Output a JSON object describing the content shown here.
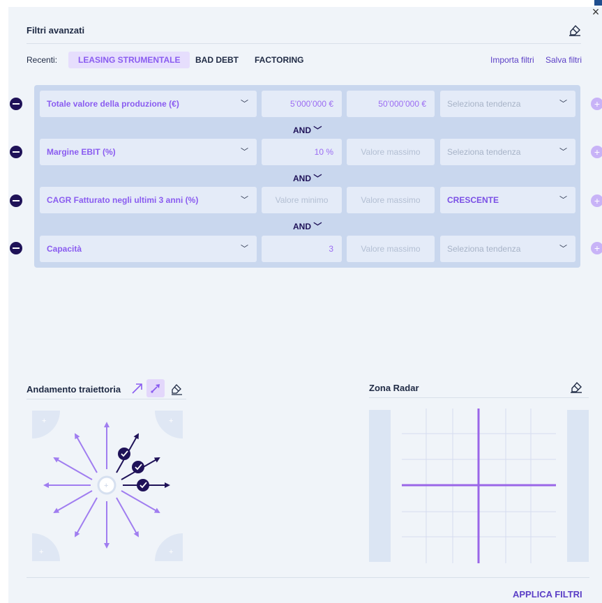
{
  "window": {
    "close_label": "×"
  },
  "header": {
    "title": "Filtri avanzati"
  },
  "recent": {
    "label": "Recenti:",
    "chips": [
      "LEASING STRUMENTALE",
      "BAD DEBT",
      "FACTORING"
    ],
    "import_label": "Importa filtri",
    "save_label": "Salva filtri"
  },
  "filters": [
    {
      "field": "Totale valore della produzione (€)",
      "min": "5’000’000  €",
      "max": "50’000’000  €",
      "trend": "Seleziona tendenza"
    },
    {
      "field": "Margine EBIT (%)",
      "min": "10  %",
      "max": "Valore massimo",
      "trend": "Seleziona tendenza"
    },
    {
      "field": "CAGR Fatturato negli ultimi 3 anni (%)",
      "min": "Valore minimo",
      "max": "Valore massimo",
      "trend": "CRESCENTE"
    },
    {
      "field": "Capacità",
      "min": "3",
      "max": "Valore massimo",
      "trend": "Seleziona tendenza"
    }
  ],
  "connectors": [
    "AND",
    "AND",
    "AND"
  ],
  "trajectory": {
    "title": "Andamento traiettoria"
  },
  "radar": {
    "title": "Zona Radar"
  },
  "footer": {
    "apply_label": "APPLICA FILTRI"
  },
  "colors": {
    "accent": "#8a5cf0",
    "dark": "#1f1258",
    "panel": "#f0f4f9",
    "box": "#c9d7ee"
  }
}
